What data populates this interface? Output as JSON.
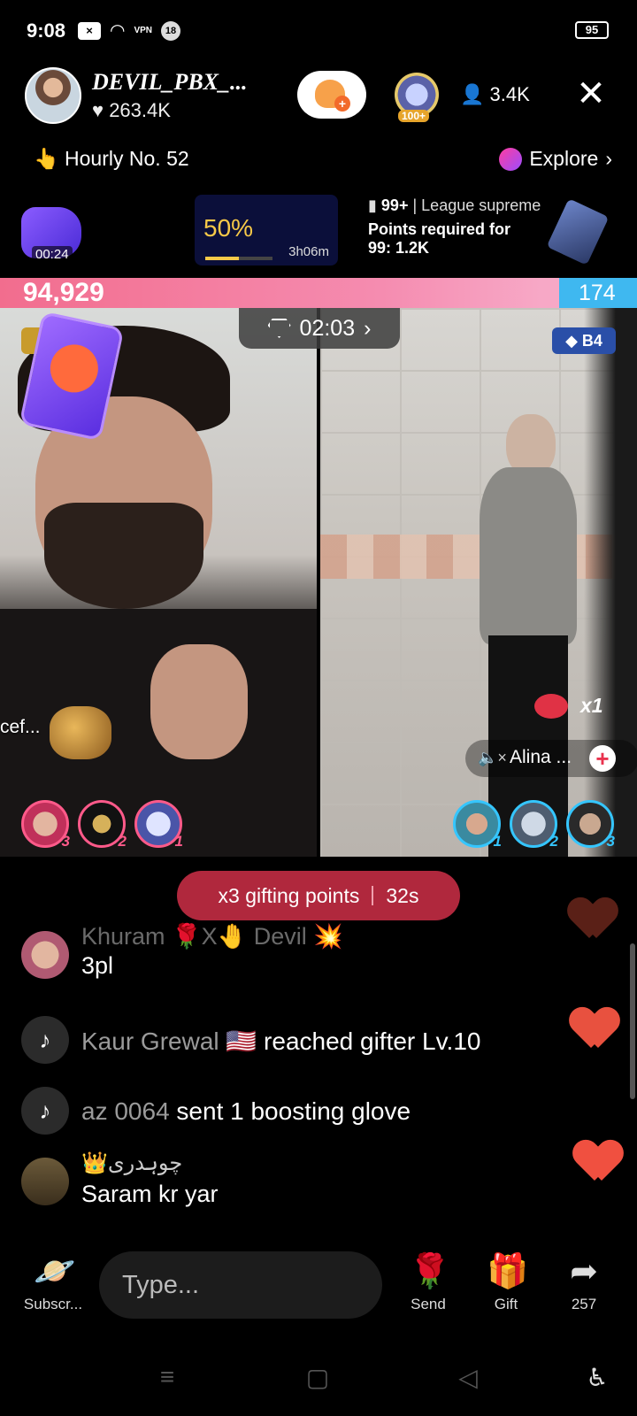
{
  "status_bar": {
    "time": "9:08",
    "vpn": "VPN",
    "notif_count": "18",
    "battery": "95"
  },
  "host": {
    "name": "DEVIL_PBX_...",
    "likes": "263.4K",
    "rank_badge": "100+",
    "viewers": "3.4K"
  },
  "ranking": {
    "hourly": "Hourly No. 52",
    "explore": "Explore"
  },
  "boost": {
    "timer": "00:24"
  },
  "progress": {
    "percent_text": "50%",
    "percent_value": 0.5,
    "time_left": "3h06m"
  },
  "league": {
    "rank": "99+",
    "name": "League supreme",
    "points_line1": "Points required for",
    "points_line2": "99: 1.2K"
  },
  "battle": {
    "left_score": "94,929",
    "right_score": "174",
    "timer": "02:03",
    "right_badge": "B4"
  },
  "left_stream": {
    "gift_label": "cef...",
    "fans": [
      "3",
      "2",
      "1"
    ]
  },
  "right_stream": {
    "multiplier": "x1",
    "name": "Alina ...",
    "fans": [
      "1",
      "2",
      "3"
    ]
  },
  "gifting_pill": {
    "label": "x3 gifting points",
    "time": "32s"
  },
  "chat": [
    {
      "user": "Khuram 🌹X🤚 Devil 💥",
      "message": "3pl"
    },
    {
      "user": "Kaur Grewal 🇺🇸",
      "message": "reached gifter Lv.10"
    },
    {
      "user": "az 0064",
      "message": "sent 1 boosting glove"
    },
    {
      "user": "👑چوہدری",
      "message": "Saram kr yar"
    }
  ],
  "bottom_bar": {
    "subscribe": "Subscr...",
    "input_placeholder": "Type...",
    "send": "Send",
    "gift": "Gift",
    "share_count": "257"
  },
  "colors": {
    "battle_left": "#f26d8e",
    "battle_right": "#3fb8f0",
    "gift_pill": "#b0283d",
    "heart": "#e85a4f"
  }
}
